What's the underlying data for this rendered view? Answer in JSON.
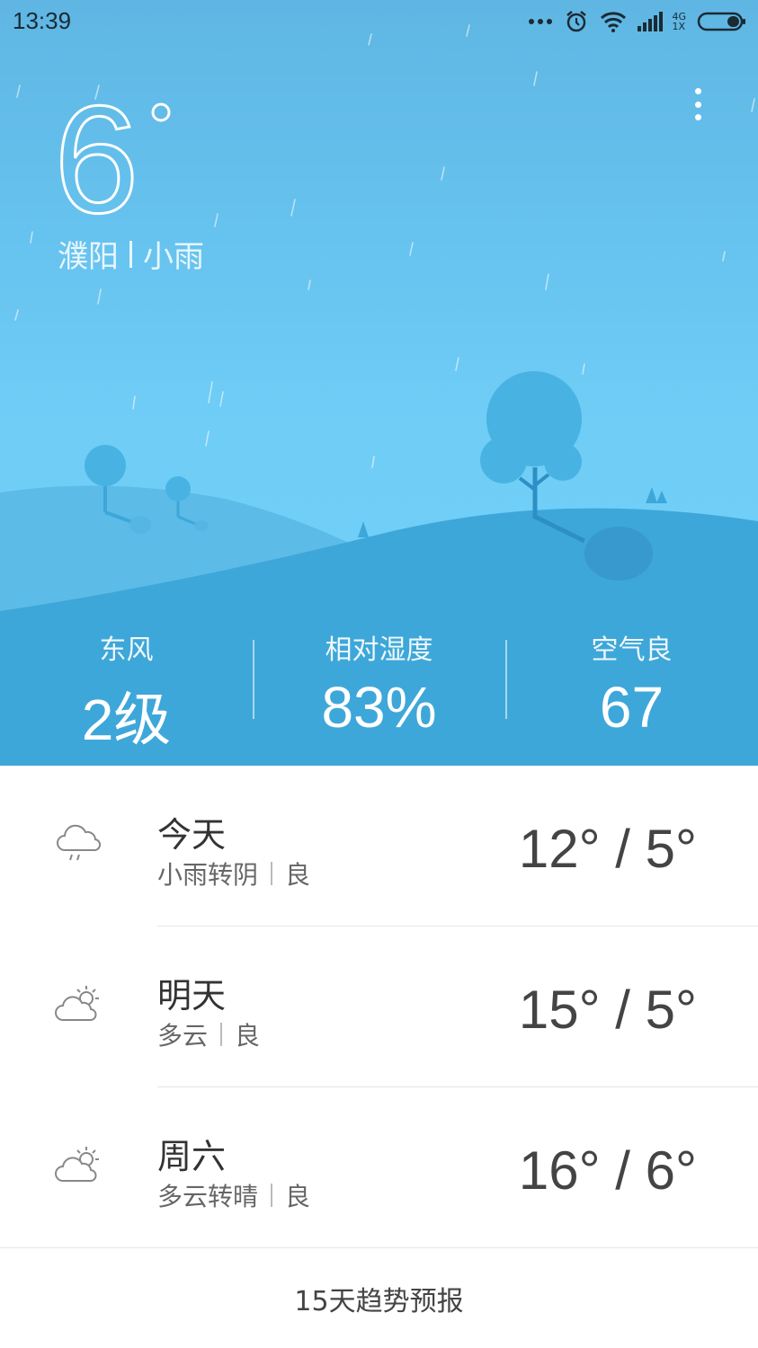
{
  "status_bar": {
    "time": "13:39",
    "network": "4G",
    "network_sub": "1X"
  },
  "current": {
    "temperature": "6",
    "degree_symbol": "°",
    "city": "濮阳",
    "condition": "小雨"
  },
  "stats": [
    {
      "label": "东风",
      "value": "2级"
    },
    {
      "label": "相对湿度",
      "value": "83%"
    },
    {
      "label": "空气良",
      "value": "67"
    }
  ],
  "forecast": [
    {
      "day": "今天",
      "condition": "小雨转阴",
      "air": "良",
      "temps": "12° / 5°",
      "icon": "rain-cloud-icon"
    },
    {
      "day": "明天",
      "condition": "多云",
      "air": "良",
      "temps": "15° / 5°",
      "icon": "partly-cloudy-icon"
    },
    {
      "day": "周六",
      "condition": "多云转晴",
      "air": "良",
      "temps": "16° / 6°",
      "icon": "partly-cloudy-icon"
    }
  ],
  "trend_link": "15天趋势预报",
  "colors": {
    "sky_top": "#5fb6e3",
    "sky_bottom": "#71cff7",
    "hill_front": "#3ea7d9",
    "tree": "#48b3e3"
  }
}
